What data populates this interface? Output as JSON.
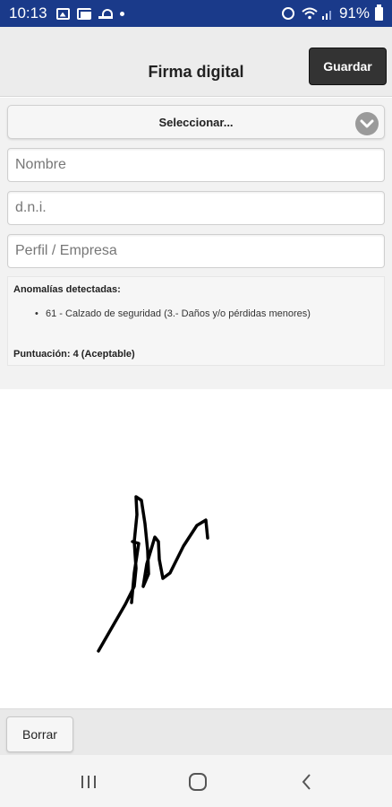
{
  "status_bar": {
    "time": "10:13",
    "battery": "91%"
  },
  "header": {
    "title": "Firma digital",
    "save_label": "Guardar"
  },
  "form": {
    "select_value": "Seleccionar...",
    "name_placeholder": "Nombre",
    "dni_placeholder": "d.n.i.",
    "profile_placeholder": "Perfil / Empresa"
  },
  "info": {
    "heading": "Anomalías detectadas:",
    "items": [
      "61 - Calzado de seguridad (3.- Daños y/o pérdidas menores)"
    ],
    "score": "Puntuación: 4 (Aceptable)"
  },
  "footer": {
    "clear_label": "Borrar"
  },
  "colors": {
    "status_bar": "#1a3a8a",
    "header_bg": "#ececec",
    "save_button": "#333333"
  }
}
